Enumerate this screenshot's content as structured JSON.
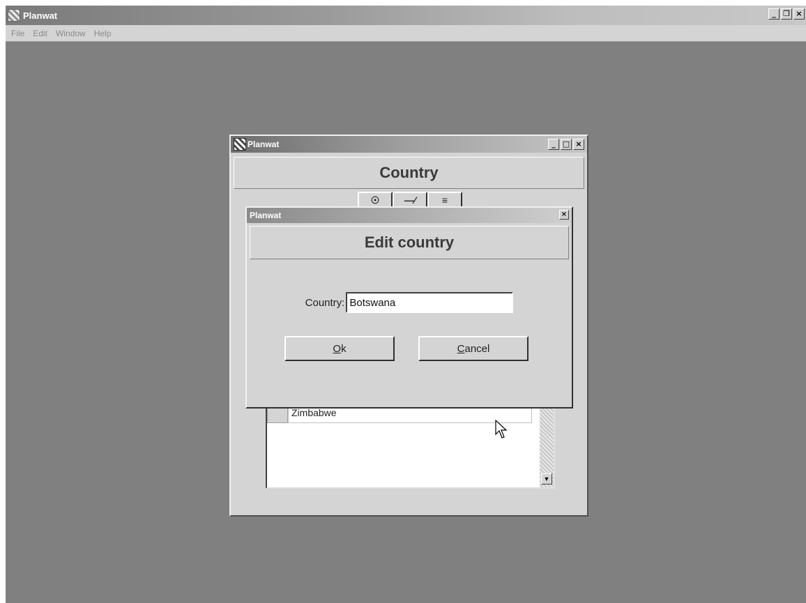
{
  "app": {
    "title": "Planwat",
    "window_controls": [
      "_",
      "ē",
      "×"
    ],
    "menu": [
      "File",
      "Edit",
      "Window",
      "Help"
    ]
  },
  "inner_window": {
    "title": "Planwat",
    "heading": "Country",
    "window_controls": [
      "_",
      "□",
      "×"
    ],
    "toolbar": [
      "☉",
      "—⁄",
      "≡"
    ],
    "list": {
      "rows": [
        "Zimbabwe"
      ],
      "scroll_down_glyph": "▼"
    }
  },
  "dialog": {
    "title": "Planwat",
    "close_glyph": "×",
    "heading": "Edit country",
    "field_label": "Country:",
    "field_value": "Botswana",
    "ok_mnemonic": "O",
    "ok_rest": "k",
    "cancel_mnemonic": "C",
    "cancel_rest": "ancel"
  }
}
